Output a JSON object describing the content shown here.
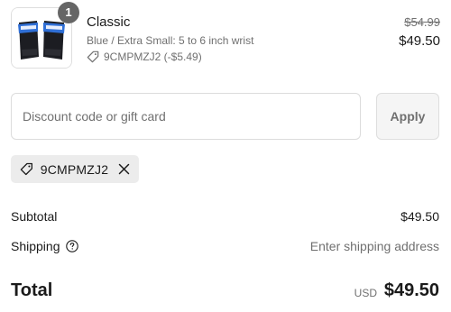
{
  "product": {
    "quantity": "1",
    "title": "Classic",
    "variant": "Blue / Extra Small: 5 to 6 inch wrist",
    "discount_line": "9CMPMZJ2 (-$5.49)",
    "compare_at_price": "$54.99",
    "price": "$49.50",
    "thumbnail_icon": "wrist-strap-product-image"
  },
  "discount": {
    "placeholder": "Discount code or gift card",
    "value": "",
    "apply_label": "Apply"
  },
  "applied_code": {
    "code": "9CMPMZJ2",
    "tag_icon": "tag-icon",
    "remove_icon": "close-icon"
  },
  "totals": {
    "subtotal_label": "Subtotal",
    "subtotal_value": "$49.50",
    "shipping_label": "Shipping",
    "shipping_value": "Enter shipping address",
    "total_label": "Total",
    "currency": "USD",
    "total_value": "$49.50"
  },
  "colors": {
    "text": "#1a1a1a",
    "muted": "#707070",
    "border": "#dcdcdc",
    "chip_bg": "#ececec",
    "badge_bg": "#666666"
  }
}
